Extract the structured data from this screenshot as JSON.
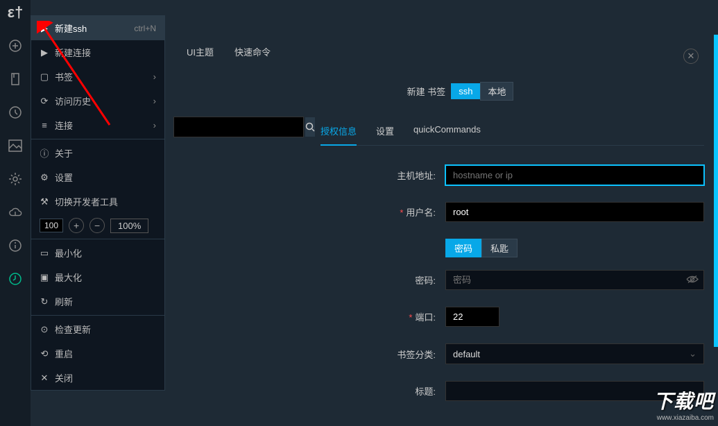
{
  "sidebar_icons": [
    "logo",
    "plus",
    "bookmark",
    "history",
    "image",
    "settings",
    "cloud",
    "info",
    "sync"
  ],
  "menu": {
    "items": [
      {
        "icon": "▶",
        "label": "新建ssh",
        "shortcut": "ctrl+N",
        "highlighted": true
      },
      {
        "icon": "▶",
        "label": "新建连接"
      },
      {
        "icon": "▢",
        "label": "书签",
        "sub": true
      },
      {
        "icon": "⟳",
        "label": "访问历史",
        "sub": true
      },
      {
        "icon": "≡",
        "label": "连接",
        "sub": true
      },
      {
        "sep": true
      },
      {
        "icon": "ⓘ",
        "label": "关于"
      },
      {
        "icon": "⚙",
        "label": "设置"
      },
      {
        "icon": "⚒",
        "label": "切换开发者工具"
      },
      {
        "zoom": true,
        "value": "100",
        "pct": "100%"
      },
      {
        "sep": true
      },
      {
        "icon": "▭",
        "label": "最小化"
      },
      {
        "icon": "▣",
        "label": "最大化"
      },
      {
        "icon": "↻",
        "label": "刷新"
      },
      {
        "sep": true
      },
      {
        "icon": "⊙",
        "label": "检查更新"
      },
      {
        "icon": "⟲",
        "label": "重启"
      },
      {
        "icon": "✕",
        "label": "关闭"
      }
    ]
  },
  "toptabs": [
    "UI主题",
    "快速命令"
  ],
  "mode": {
    "prefix": "新建 书签",
    "tabs": [
      "ssh",
      "本地"
    ],
    "active": 0
  },
  "form_tabs": [
    "授权信息",
    "设置",
    "quickCommands"
  ],
  "form": {
    "host_label": "主机地址:",
    "host_placeholder": "hostname or ip",
    "user_label": "用户名:",
    "user_value": "root",
    "pw_tabs": [
      "密码",
      "私匙"
    ],
    "pw_label": "密码:",
    "pw_placeholder": "密码",
    "port_label": "端口:",
    "port_value": "22",
    "category_label": "书签分类:",
    "category_value": "default",
    "title_label": "标题:"
  },
  "watermark": {
    "text": "下载吧",
    "url": "www.xiazaiba.com"
  }
}
